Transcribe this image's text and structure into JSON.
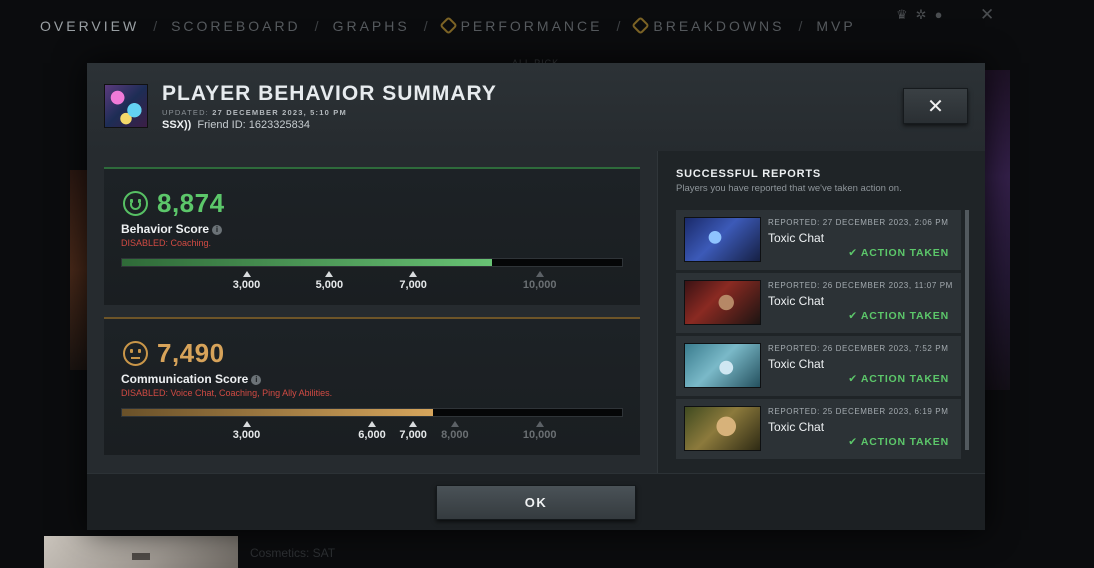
{
  "background": {
    "nav": [
      "OVERVIEW",
      "SCOREBOARD",
      "GRAPHS",
      "PERFORMANCE",
      "BREAKDOWNS",
      "MVP"
    ],
    "bottom_text": "Cosmetics: SAT",
    "allpick_text": "ALL PICK"
  },
  "modal": {
    "title": "PLAYER BEHAVIOR SUMMARY",
    "updated_label": "UPDATED:",
    "updated_value": "27 DECEMBER 2023, 5:10 PM",
    "player_name": "SSX))",
    "friend_id": "Friend ID: 1623325834",
    "close_label": "✕",
    "ok_label": "OK"
  },
  "behavior": {
    "value": "8,874",
    "label": "Behavior Score",
    "disabled": "DISABLED: Coaching.",
    "progress": 0.74,
    "ticks": [
      {
        "label": "3,000",
        "pos": 0.25,
        "reached": true
      },
      {
        "label": "5,000",
        "pos": 0.415,
        "reached": true
      },
      {
        "label": "7,000",
        "pos": 0.582,
        "reached": true
      },
      {
        "label": "10,000",
        "pos": 0.834,
        "reached": false
      }
    ]
  },
  "communication": {
    "value": "7,490",
    "label": "Communication Score",
    "disabled": "DISABLED: Voice Chat, Coaching, Ping Ally Abilities.",
    "progress": 0.622,
    "ticks": [
      {
        "label": "3,000",
        "pos": 0.25,
        "reached": true
      },
      {
        "label": "6,000",
        "pos": 0.5,
        "reached": true
      },
      {
        "label": "7,000",
        "pos": 0.582,
        "reached": true
      },
      {
        "label": "8,000",
        "pos": 0.665,
        "reached": false
      },
      {
        "label": "10,000",
        "pos": 0.834,
        "reached": false
      }
    ]
  },
  "reports": {
    "title": "SUCCESSFUL REPORTS",
    "subtitle": "Players you have reported that we've taken action on.",
    "items": [
      {
        "reported": "REPORTED: 27 DECEMBER 2023, 2:06 PM",
        "reason": "Toxic Chat",
        "status": "ACTION TAKEN"
      },
      {
        "reported": "REPORTED: 26 DECEMBER 2023, 11:07 PM",
        "reason": "Toxic Chat",
        "status": "ACTION TAKEN"
      },
      {
        "reported": "REPORTED: 26 DECEMBER 2023, 7:52 PM",
        "reason": "Toxic Chat",
        "status": "ACTION TAKEN"
      },
      {
        "reported": "REPORTED: 25 DECEMBER 2023, 6:19 PM",
        "reason": "Toxic Chat",
        "status": "ACTION TAKEN"
      }
    ]
  }
}
